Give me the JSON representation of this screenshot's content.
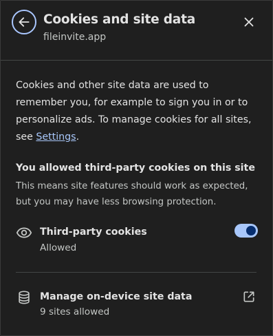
{
  "header": {
    "title": "Cookies and site data",
    "site": "fileinvite.app",
    "back_icon": "arrow-back-icon",
    "close_icon": "close-icon"
  },
  "description": {
    "text_before_link": "Cookies and other site data are used to remember you, for example to sign you in or to personalize ads. To manage cookies for all sites, see ",
    "link_label": "Settings",
    "text_after_link": "."
  },
  "third_party_notice": {
    "title": "You allowed third-party cookies on this site",
    "body": "This means site features should work as expected, but you may have less browsing protection."
  },
  "third_party_cookies": {
    "icon": "eye-icon",
    "label": "Third-party cookies",
    "status": "Allowed",
    "enabled": true
  },
  "site_data": {
    "icon": "database-icon",
    "label": "Manage on-device site data",
    "status": "9 sites allowed",
    "action_icon": "open-in-new-icon"
  },
  "colors": {
    "background": "#1f1f1f",
    "accent": "#a8c7fa",
    "text": "#e3e3e3",
    "secondary_text": "#c4c7c5",
    "divider": "#444746"
  }
}
